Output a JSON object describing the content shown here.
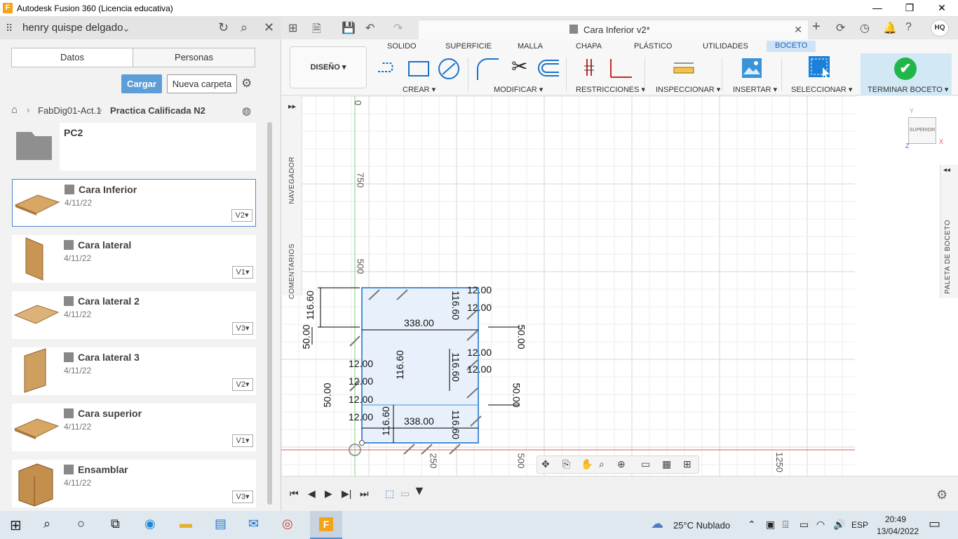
{
  "window": {
    "title": "Autodesk Fusion 360 (Licencia educativa)",
    "app_icon_letter": "F",
    "minimize": "—",
    "restore": "❐",
    "close": "✕"
  },
  "left_panel": {
    "user_name": "henry quispe delgado",
    "tabs": [
      "Datos",
      "Personas"
    ],
    "upload_button": "Cargar",
    "new_folder_button": "Nueva carpeta",
    "breadcrumb": [
      "FabDig01-Act.1",
      "Practica Calificada N2"
    ],
    "items": [
      {
        "name": "PC2",
        "type": "folder"
      },
      {
        "name": "Cara Inferior",
        "date": "4/11/22",
        "version": "V2"
      },
      {
        "name": "Cara lateral",
        "date": "4/11/22",
        "version": "V1"
      },
      {
        "name": "Cara lateral 2",
        "date": "4/11/22",
        "version": "V3"
      },
      {
        "name": "Cara lateral 3",
        "date": "4/11/22",
        "version": "V2"
      },
      {
        "name": "Cara superior",
        "date": "4/11/22",
        "version": "V1"
      },
      {
        "name": "Ensamblar",
        "date": "4/11/22",
        "version": "V3"
      }
    ]
  },
  "tabbar": {
    "document_title": "Cara Inferior v2*",
    "avatar_initials": "HQ"
  },
  "ribbon": {
    "workspace": "DISEÑO",
    "tabs": [
      "SOLIDO",
      "SUPERFICIE",
      "MALLA",
      "CHAPA",
      "PLÁSTICO",
      "UTILIDADES",
      "BOCETO"
    ],
    "active_tab": "BOCETO",
    "groups": [
      "CREAR",
      "MODIFICAR",
      "RESTRICCIONES",
      "INSPECCIONAR",
      "INSERTAR",
      "SELECCIONAR"
    ],
    "finish_button": "TERMINAR BOCETO"
  },
  "canvas": {
    "side_tabs": [
      "NAVEGADOR",
      "COMENTARIOS"
    ],
    "right_tab": "PALETA DE BOCETO",
    "viewcube_label": "SUPERIOR",
    "axis_labels": {
      "y": "Y",
      "x": "X",
      "z": "Z"
    },
    "ruler_labels": [
      "0",
      "750",
      "500",
      "250",
      "500",
      "1250"
    ],
    "dimensions": {
      "top_width": "338.00",
      "bottom_width": "338.00",
      "height_116": "116.60",
      "side_50": "50.00",
      "slot_12": "12.00"
    }
  },
  "taskbar": {
    "weather": "25°C  Nublado",
    "language": "ESP",
    "time": "20:49",
    "date": "13/04/2022"
  }
}
